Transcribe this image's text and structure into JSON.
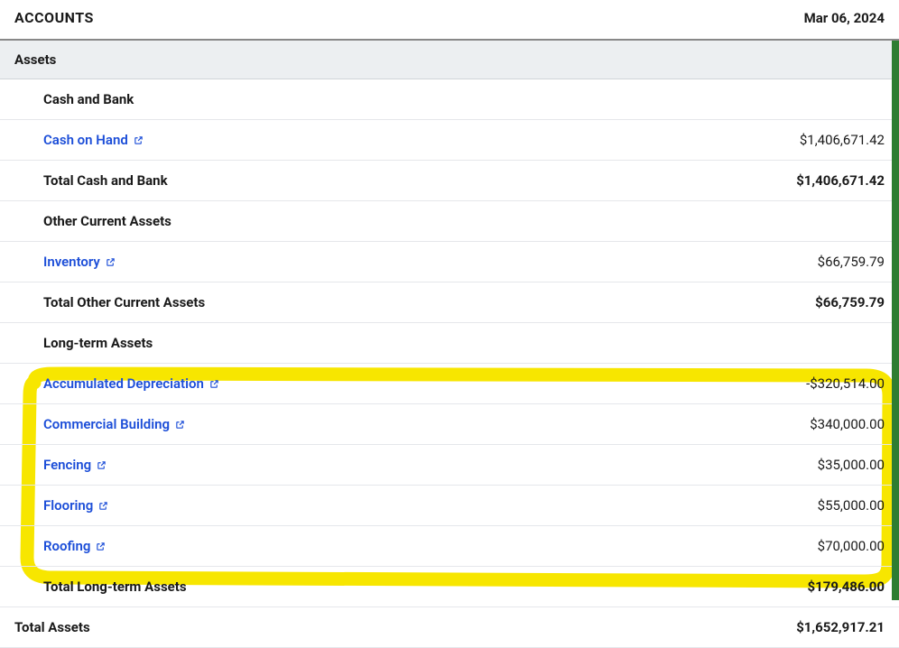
{
  "header": {
    "title": "ACCOUNTS",
    "date": "Mar 06, 2024"
  },
  "sections": {
    "assets": {
      "label": "Assets",
      "cash_and_bank": {
        "label": "Cash and Bank",
        "cash_on_hand": {
          "label": "Cash on Hand",
          "value": "$1,406,671.42"
        },
        "total": {
          "label": "Total Cash and Bank",
          "value": "$1,406,671.42"
        }
      },
      "other_current": {
        "label": "Other Current Assets",
        "inventory": {
          "label": "Inventory",
          "value": "$66,759.79"
        },
        "total": {
          "label": "Total Other Current Assets",
          "value": "$66,759.79"
        }
      },
      "long_term": {
        "label": "Long-term Assets",
        "accumulated_depreciation": {
          "label": "Accumulated Depreciation",
          "value": "-$320,514.00"
        },
        "commercial_building": {
          "label": "Commercial Building",
          "value": "$340,000.00"
        },
        "fencing": {
          "label": "Fencing",
          "value": "$35,000.00"
        },
        "flooring": {
          "label": "Flooring",
          "value": "$55,000.00"
        },
        "roofing": {
          "label": "Roofing",
          "value": "$70,000.00"
        },
        "total": {
          "label": "Total Long-term Assets",
          "value": "$179,486.00"
        }
      },
      "total": {
        "label": "Total Assets",
        "value": "$1,652,917.21"
      }
    }
  },
  "annotation": {
    "color": "#f7e600",
    "description": "Hand-drawn yellow highlight circling Commercial Building through Total Long-term Assets rows"
  }
}
